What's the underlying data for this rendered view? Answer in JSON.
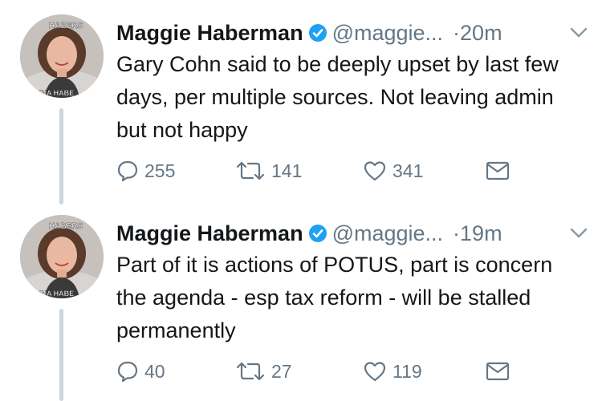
{
  "tweets": [
    {
      "author_name": "Maggie Haberman",
      "handle": "@maggie...",
      "separator": "·",
      "time": "20m",
      "text": "Gary Cohn said to be deeply upset by last few days, per multiple sources. Not leaving admin but not happy",
      "replies": "255",
      "retweets": "141",
      "likes": "341",
      "avatar_text_top": "HABERS",
      "avatar_text_bottom": "GONNA HABE"
    },
    {
      "author_name": "Maggie Haberman",
      "handle": "@maggie...",
      "separator": "·",
      "time": "19m",
      "text": "Part of it is actions of POTUS, part is concern the agenda - esp tax reform - will be stalled permanently",
      "replies": "40",
      "retweets": "27",
      "likes": "119",
      "avatar_text_top": "HABERS",
      "avatar_text_bottom": "GONNA HABE"
    }
  ],
  "icons": {
    "verified": "verified-badge-icon",
    "caret": "chevron-down-icon",
    "reply": "reply-icon",
    "retweet": "retweet-icon",
    "like": "heart-icon",
    "dm": "direct-message-icon"
  },
  "colors": {
    "text": "#14171a",
    "secondary": "#657786",
    "verified": "#1da1f2",
    "thread_line": "#ccd6dd"
  }
}
